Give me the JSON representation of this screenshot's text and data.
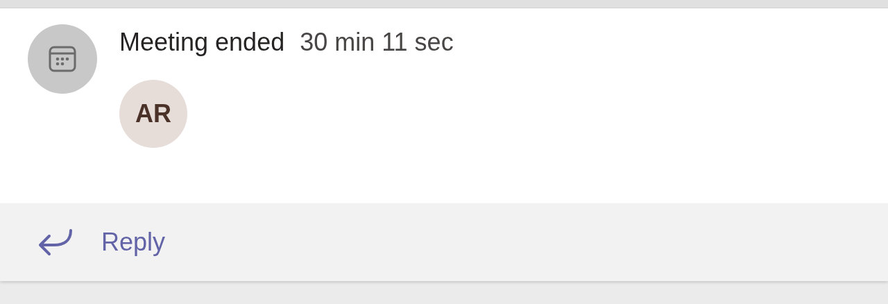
{
  "event": {
    "title": "Meeting ended",
    "duration": "30 min 11 sec"
  },
  "participants": [
    {
      "initials": "AR"
    }
  ],
  "reply": {
    "label": "Reply"
  }
}
